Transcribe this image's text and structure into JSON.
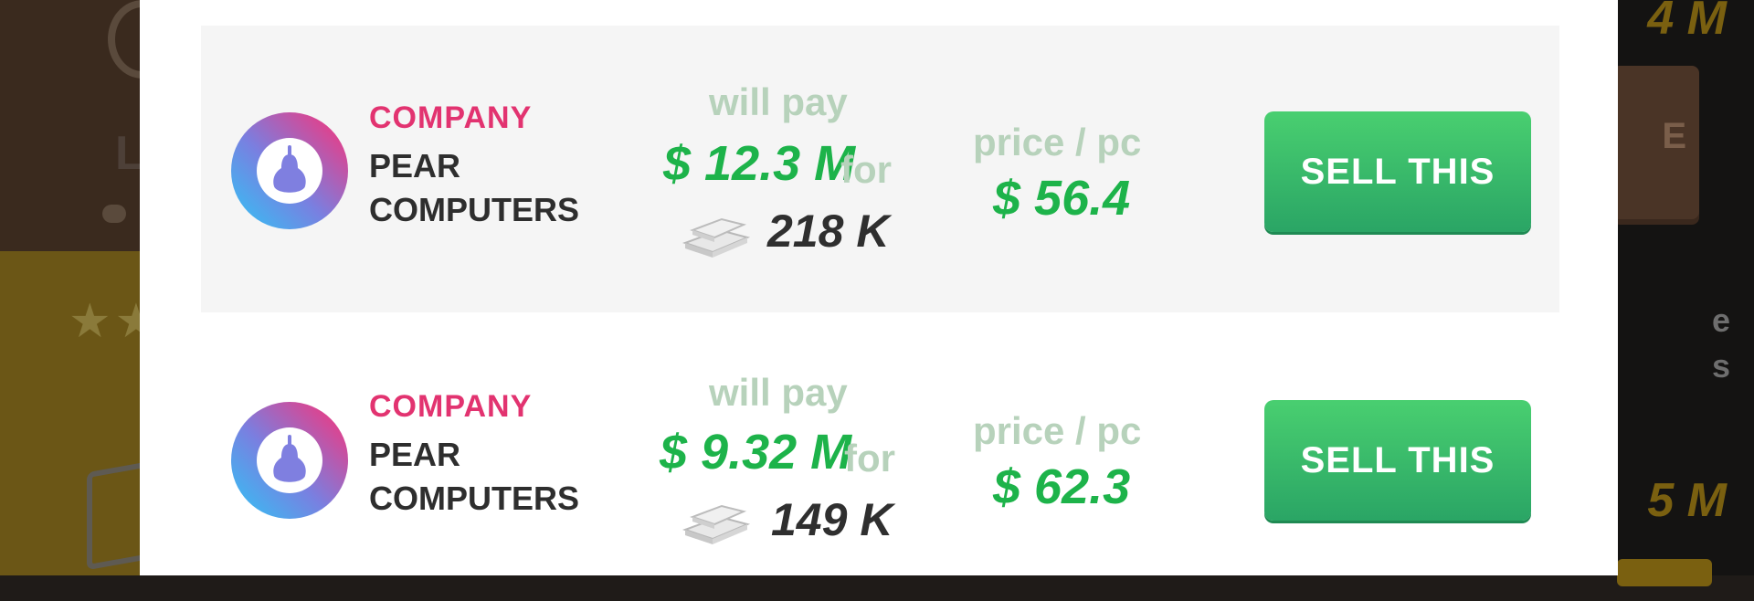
{
  "background": {
    "right_button_text": "E",
    "right_money_top": "4 M",
    "right_money_bottom": "5 M",
    "right_text_line1": "e",
    "right_text_line2": "s",
    "left_letter": "L",
    "stars": "★★"
  },
  "offers": [
    {
      "company_label": "COMPANY",
      "company_name": "PEAR COMPUTERS",
      "logo_icon": "pear-icon",
      "will_pay_label": "will pay",
      "amount": "$ 12.3 M",
      "for_label": "for",
      "item_icon": "silver-bars-icon",
      "quantity": "218 K",
      "price_label": "price / pc",
      "price": "$ 56.4",
      "sell_label": "SELL THIS"
    },
    {
      "company_label": "COMPANY",
      "company_name": "PEAR COMPUTERS",
      "logo_icon": "pear-icon",
      "will_pay_label": "will pay",
      "amount": "$ 9.32 M",
      "for_label": "for",
      "item_icon": "silver-bars-icon",
      "quantity": "149 K",
      "price_label": "price / pc",
      "price": "$ 62.3",
      "sell_label": "SELL THIS"
    }
  ],
  "colors": {
    "company_label": "#e23370",
    "money_green": "#1db34a",
    "muted_label": "#b7d2bb",
    "button_green": "#2aa565"
  }
}
